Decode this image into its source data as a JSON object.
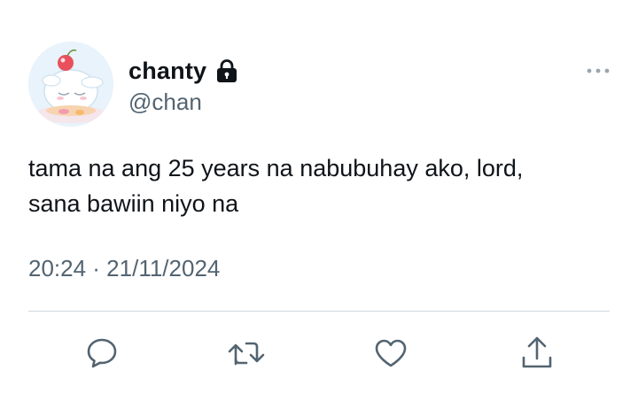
{
  "tweet": {
    "display_name": "chanty",
    "handle": "@chan",
    "protected_icon": "lock-icon",
    "text": "tama na ang 25 years na nabubuhay ako, lord,\nsana bawiin niyo na",
    "timestamp": "20:24 · 21/11/2024"
  },
  "icons": {
    "more": "more-horizontal-icon",
    "reply": "reply-icon",
    "retweet": "retweet-icon",
    "like": "heart-icon",
    "share": "share-icon"
  },
  "colors": {
    "text_primary": "#0f1419",
    "text_secondary": "#536471",
    "icon": "#536471",
    "divider": "#cfd9de"
  }
}
